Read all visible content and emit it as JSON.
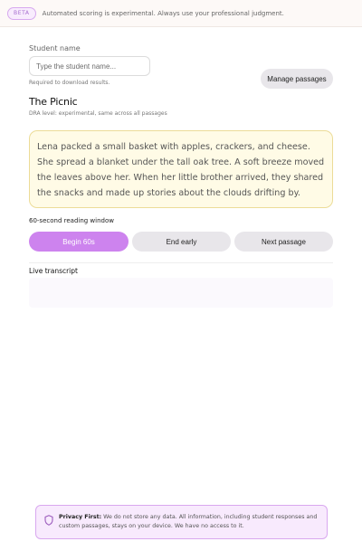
{
  "banner": {
    "badge": "BETA",
    "text": "Automated scoring is experimental. Always use your professional judgment."
  },
  "student": {
    "label": "Student name",
    "placeholder": "Type the student name...",
    "hint": "Required to download results."
  },
  "manage_button": "Manage passages",
  "passage": {
    "title": "The Picnic",
    "subtitle": "DRA level: experimental, same across all passages",
    "text": "Lena packed a small basket with apples, crackers, and cheese. She spread a blanket under the tall oak tree. A soft breeze moved the leaves above her. When her little brother arrived, they shared the snacks and made up stories about the clouds drifting by."
  },
  "reading_window_label": "60-second reading window",
  "controls": {
    "begin": "Begin 60s",
    "end": "End early",
    "next": "Next passage"
  },
  "transcript": {
    "label": "Live transcript"
  },
  "privacy": {
    "heading": "Privacy First:",
    "text": " We do not store any data. All information, including student responses and custom passages, stays on your device. We have no access to it."
  },
  "colors": {
    "accent": "#cd83ee",
    "passage_bg": "#fffbe6",
    "privacy_bg": "#f8eafd"
  },
  "icons": {
    "privacy": "shield-icon"
  }
}
